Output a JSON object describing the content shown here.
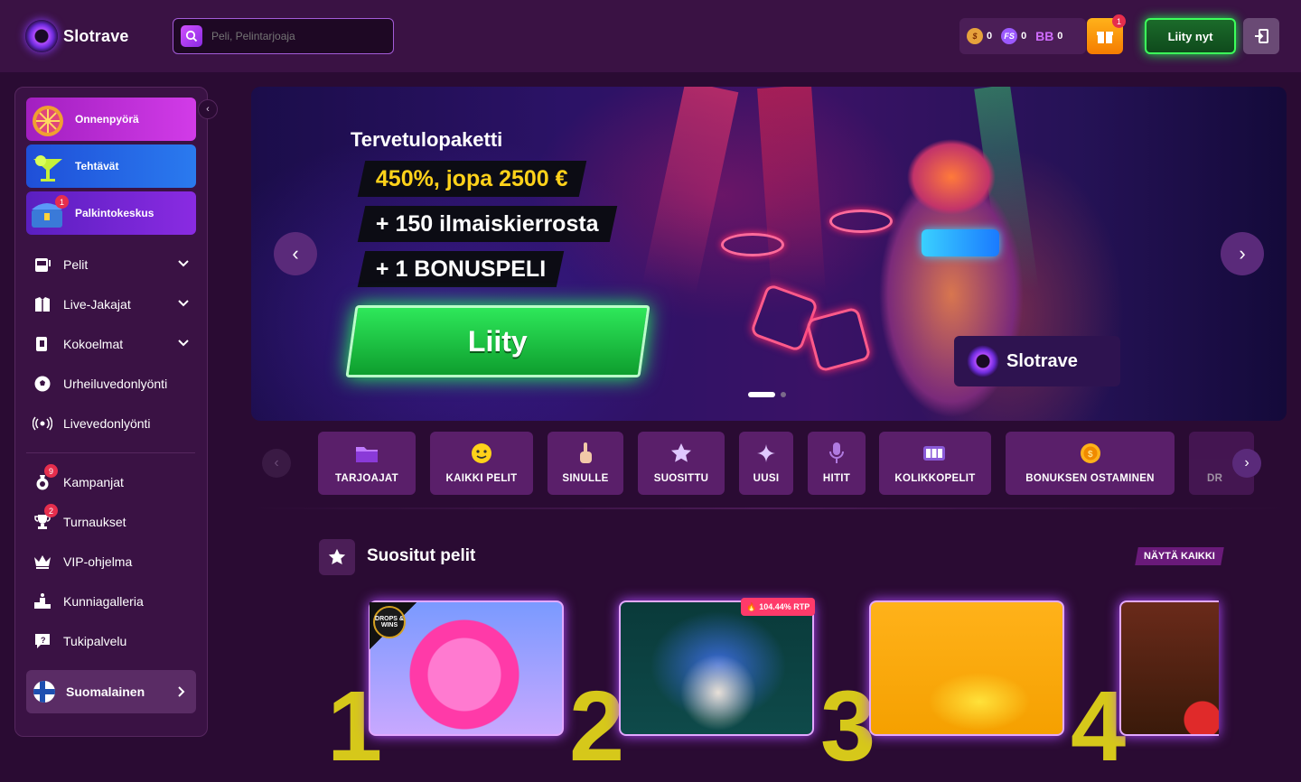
{
  "header": {
    "brand": "Slotrave",
    "search_placeholder": "Peli, Pelintarjoaja",
    "wallet": [
      {
        "icon": "coin-icon",
        "value": "0",
        "color": "#e6a23c"
      },
      {
        "icon": "free-spins-icon",
        "label": "FS",
        "value": "0",
        "color": "#9b59ff"
      },
      {
        "icon": "bonus-balance-icon",
        "label": "BB",
        "value": "0",
        "color": "#d06cff"
      }
    ],
    "gift_badge": "1",
    "join_label": "Liity nyt"
  },
  "sidebar": {
    "promos": [
      {
        "label": "Onnenpyörä",
        "icon": "wheel-of-fortune-icon",
        "color": "#c43be0"
      },
      {
        "label": "Tehtävät",
        "icon": "cocktail-icon",
        "color": "#2a6be8"
      },
      {
        "label": "Palkintokeskus",
        "icon": "treasure-chest-icon",
        "color": "#7a2be0",
        "badge": "1"
      }
    ],
    "nav": [
      {
        "label": "Pelit",
        "icon": "slot-machine-icon",
        "expandable": true
      },
      {
        "label": "Live-Jakajat",
        "icon": "dealer-icon",
        "expandable": true
      },
      {
        "label": "Kokoelmat",
        "icon": "collection-icon",
        "expandable": true
      },
      {
        "label": "Urheiluvedonlyönti",
        "icon": "soccer-ball-icon"
      },
      {
        "label": "Livevedonlyönti",
        "icon": "live-signal-icon"
      }
    ],
    "nav2": [
      {
        "label": "Kampanjat",
        "icon": "medal-icon",
        "badge": "9"
      },
      {
        "label": "Turnaukset",
        "icon": "trophy-icon",
        "badge": "2"
      },
      {
        "label": "VIP-ohjelma",
        "icon": "crown-icon"
      },
      {
        "label": "Kunniagalleria",
        "icon": "podium-icon"
      },
      {
        "label": "Tukipalvelu",
        "icon": "support-chat-icon"
      }
    ],
    "language": "Suomalainen"
  },
  "hero": {
    "title": "Tervetulopaketti",
    "line1": "450%, jopa 2500 €",
    "line2": "+ 150 ilmaiskierrosta",
    "line3": "+ 1 BONUSPELI",
    "cta": "Liity",
    "brand_label": "Slotrave",
    "slide_count": 2,
    "active_slide": 1
  },
  "categories": [
    {
      "label": "TARJOAJAT",
      "icon": "folder-icon"
    },
    {
      "label": "KAIKKI PELIT",
      "icon": "smiley-icon"
    },
    {
      "label": "SINULLE",
      "icon": "pointing-hand-icon"
    },
    {
      "label": "SUOSITTU",
      "icon": "star-icon"
    },
    {
      "label": "UUSI",
      "icon": "sparkle-icon"
    },
    {
      "label": "HITIT",
      "icon": "microphone-icon"
    },
    {
      "label": "KOLIKKOPELIT",
      "icon": "slot-reels-icon"
    },
    {
      "label": "BONUKSEN OSTAMINEN",
      "icon": "gold-coin-icon"
    },
    {
      "label": "DR",
      "icon": "partial-icon"
    }
  ],
  "section": {
    "title": "Suositut pelit",
    "show_all": "NÄYTÄ KAIKKI",
    "rtp_badge": "104.44% RTP",
    "drops_wins": "DROPS & WINS",
    "ranks": [
      "1",
      "2",
      "3",
      "4"
    ]
  }
}
